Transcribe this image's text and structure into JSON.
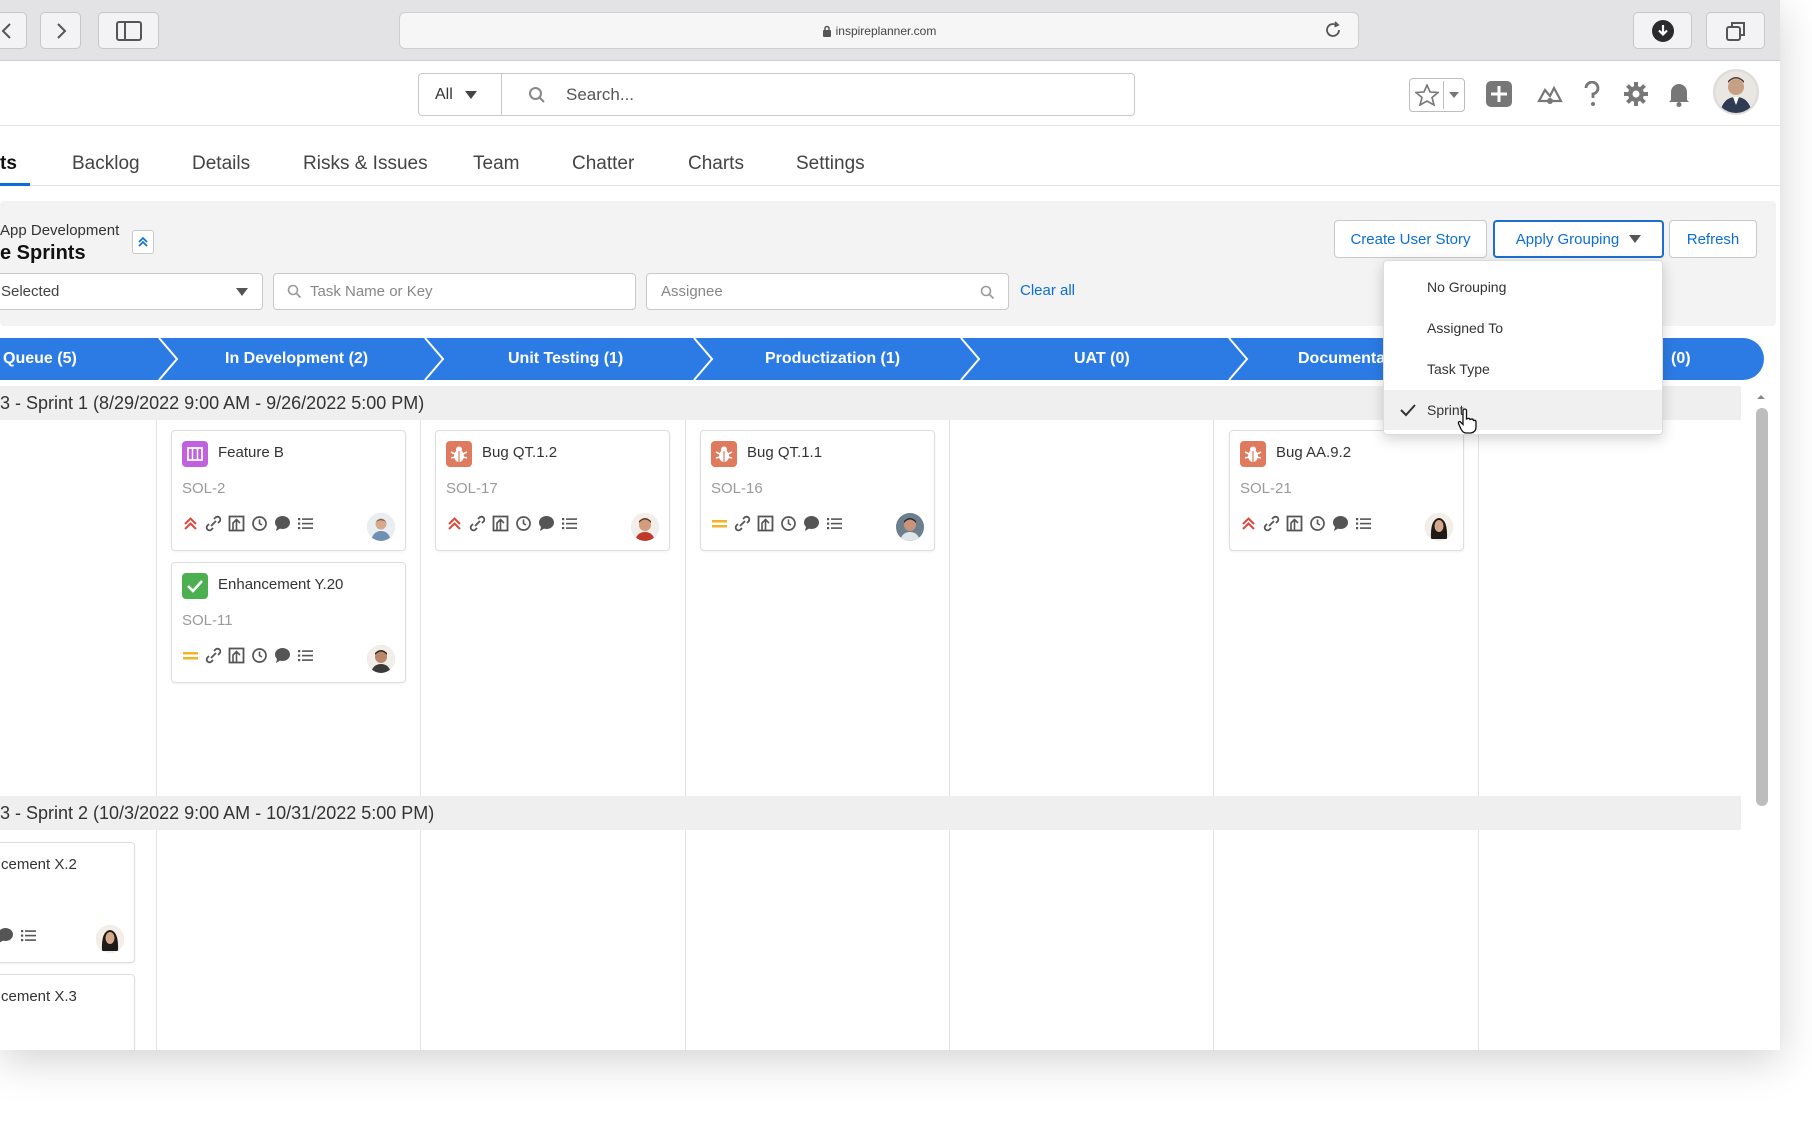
{
  "browser": {
    "url": "inspireplanner.com"
  },
  "search": {
    "scope": "All",
    "placeholder": "Search..."
  },
  "tabs": [
    {
      "label": "ts",
      "active": true
    },
    {
      "label": "Backlog"
    },
    {
      "label": "Details"
    },
    {
      "label": "Risks & Issues"
    },
    {
      "label": "Team"
    },
    {
      "label": "Chatter"
    },
    {
      "label": "Charts"
    },
    {
      "label": "Settings"
    }
  ],
  "project": {
    "subtitle": "App Development",
    "title": "e Sprints"
  },
  "filters": {
    "status_value": "Selected",
    "task_placeholder": "Task Name or Key",
    "assignee_placeholder": "Assignee",
    "clear_all": "Clear all"
  },
  "actions": {
    "create": "Create User Story",
    "grouping": "Apply Grouping",
    "refresh": "Refresh"
  },
  "stages": [
    {
      "label": "Queue  (5)"
    },
    {
      "label": "In Development  (2)"
    },
    {
      "label": "Unit Testing  (1)"
    },
    {
      "label": "Productization  (1)"
    },
    {
      "label": "UAT  (0)"
    },
    {
      "label": "Documenta"
    },
    {
      "label": "(0)"
    }
  ],
  "sprints": [
    {
      "title": "3 - Sprint 1 (8/29/2022 9:00 AM - 9/26/2022 5:00 PM)"
    },
    {
      "title": "3 - Sprint 2 (10/3/2022 9:00 AM - 10/31/2022 5:00 PM)"
    }
  ],
  "cards": [
    {
      "title": "Feature B",
      "key": "SOL-2",
      "type": "feature",
      "priority": "high"
    },
    {
      "title": "Enhancement Y.20",
      "key": "SOL-11",
      "type": "enhancement",
      "priority": "medium"
    },
    {
      "title": "Bug QT.1.2",
      "key": "SOL-17",
      "type": "bug",
      "priority": "high"
    },
    {
      "title": "Bug QT.1.1",
      "key": "SOL-16",
      "type": "bug",
      "priority": "medium"
    },
    {
      "title": "Bug AA.9.2",
      "key": "SOL-21",
      "type": "bug",
      "priority": "high"
    },
    {
      "title": "cement X.2",
      "key": "",
      "type": "enhancement",
      "priority": ""
    },
    {
      "title": "cement X.3",
      "key": "",
      "type": "enhancement",
      "priority": ""
    }
  ],
  "grouping_menu": {
    "items": [
      {
        "label": "No Grouping"
      },
      {
        "label": "Assigned To"
      },
      {
        "label": "Task Type"
      },
      {
        "label": "Sprint",
        "selected": true
      }
    ]
  },
  "colors": {
    "accent": "#2c7be5",
    "link": "#0b6ed8",
    "bug": "#e07a5f",
    "feature": "#c061e0",
    "enhancement": "#4caf50",
    "priority_high": "#e0483b",
    "priority_medium": "#f0b429"
  }
}
